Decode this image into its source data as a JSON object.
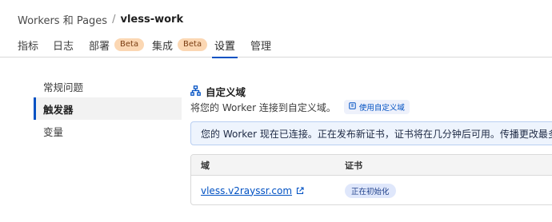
{
  "breadcrumb": {
    "parent": "Workers 和 Pages",
    "separator": "/",
    "current": "vless-work"
  },
  "tabs": [
    {
      "label": "指标"
    },
    {
      "label": "日志"
    },
    {
      "label": "部署",
      "badge": "Beta"
    },
    {
      "label": "集成",
      "badge": "Beta"
    },
    {
      "label": "设置",
      "active": true
    },
    {
      "label": "管理"
    }
  ],
  "sidebar": {
    "items": [
      {
        "label": "常规问题"
      },
      {
        "label": "触发器",
        "active": true
      },
      {
        "label": "变量"
      }
    ]
  },
  "custom_domain": {
    "icon": "sitemap-icon",
    "title": "自定义域",
    "description": "将您的 Worker 连接到自定义域。",
    "link_label": "使用自定义域",
    "link_icon": "document-icon",
    "banner": "您的 Worker 现在已连接。正在发布新证书，证书将在几分钟后可用。传播更改最多可能需",
    "table": {
      "headers": {
        "domain": "域",
        "certificate": "证书"
      },
      "rows": [
        {
          "domain": "vless.v2rayssr.com",
          "status": "正在初始化",
          "link_icon": "external-link-icon"
        }
      ]
    }
  },
  "colors": {
    "accent": "#0051c3",
    "beta_bg": "#fbd7b3",
    "banner_bg": "#eef4fd",
    "status_bg": "#dfe7fb"
  }
}
